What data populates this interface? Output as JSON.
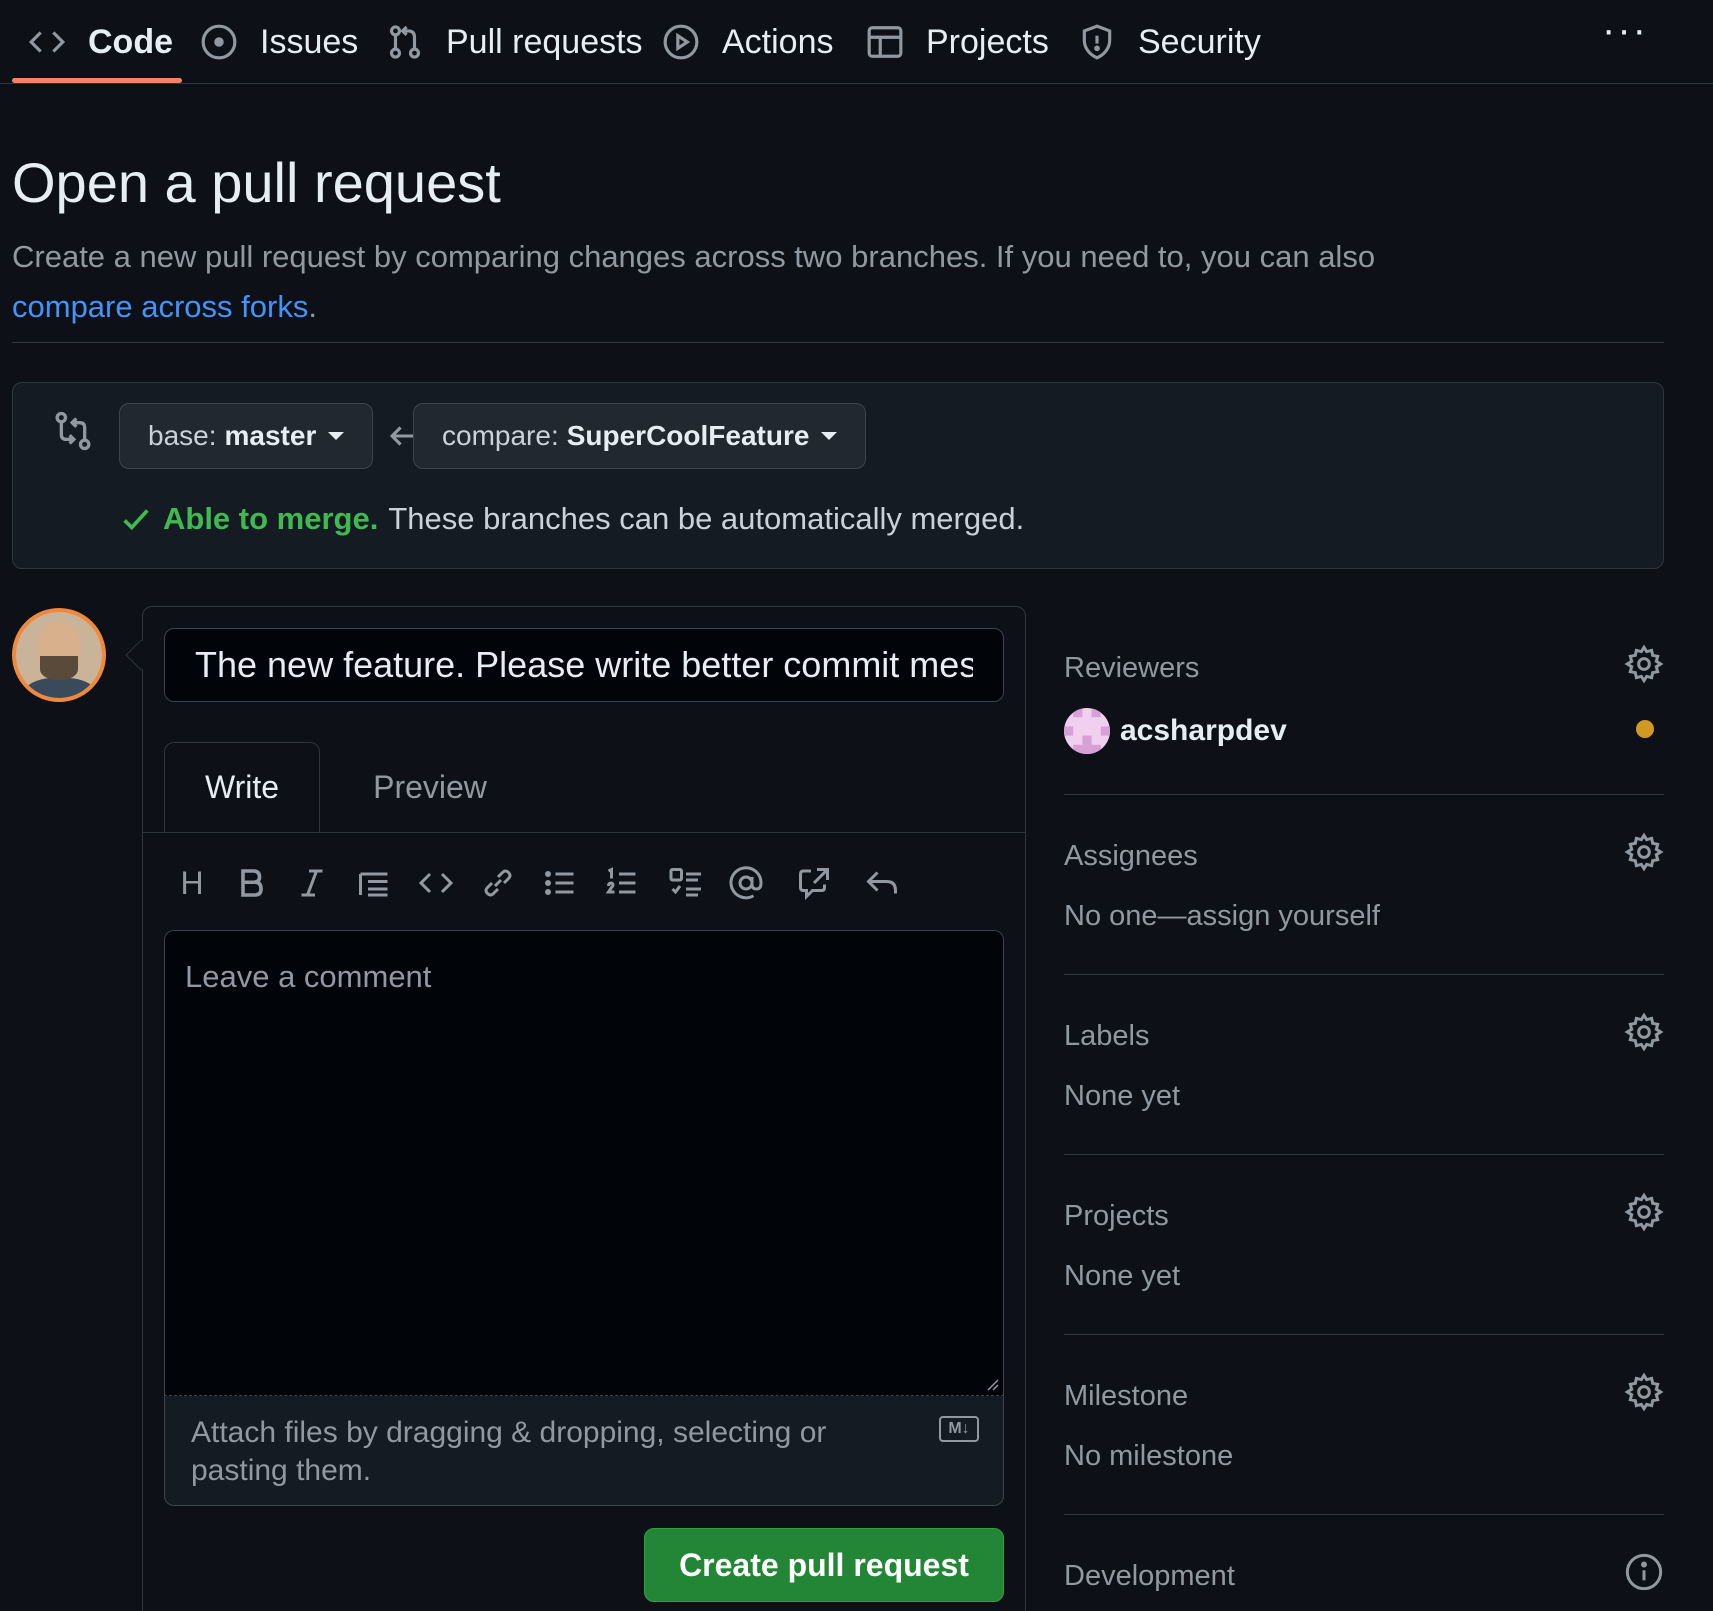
{
  "nav": {
    "tabs": [
      {
        "label": "Code",
        "icon": "code-icon"
      },
      {
        "label": "Issues",
        "icon": "issue-opened-icon"
      },
      {
        "label": "Pull requests",
        "icon": "git-pull-request-icon"
      },
      {
        "label": "Actions",
        "icon": "play-icon"
      },
      {
        "label": "Projects",
        "icon": "table-icon"
      },
      {
        "label": "Security",
        "icon": "shield-icon"
      }
    ],
    "more": "···"
  },
  "header": {
    "title": "Open a pull request",
    "description": "Create a new pull request by comparing changes across two branches. If you need to, you can also",
    "fork_link": "compare across forks",
    "fork_link_suffix": "."
  },
  "compare": {
    "base_prefix": "base:",
    "base_value": "master",
    "compare_prefix": "compare:",
    "compare_value": "SuperCoolFeature",
    "merge_ok": "Able to merge.",
    "merge_text": "These branches can be automatically merged."
  },
  "editor": {
    "title_value": "The new feature. Please write better commit messages",
    "tab_write": "Write",
    "tab_preview": "Preview",
    "heading_tool": "H",
    "comment_placeholder": "Leave a comment",
    "attach_text": "Attach files by dragging & dropping, selecting or pasting them.",
    "markdown_badge": "M↓",
    "submit": "Create pull request"
  },
  "sidebar": {
    "reviewers": {
      "heading": "Reviewers",
      "user": "acsharpdev",
      "status_color": "#d29922"
    },
    "assignees": {
      "heading": "Assignees",
      "value": "No one—assign yourself"
    },
    "labels": {
      "heading": "Labels",
      "value": "None yet"
    },
    "projects": {
      "heading": "Projects",
      "value": "None yet"
    },
    "milestone": {
      "heading": "Milestone",
      "value": "No milestone"
    },
    "development": {
      "heading": "Development"
    }
  },
  "colors": {
    "background": "#0d1117",
    "accent_underline": "#f78166",
    "link": "#4493f8",
    "success": "#3fb950",
    "button_green": "#238636"
  }
}
